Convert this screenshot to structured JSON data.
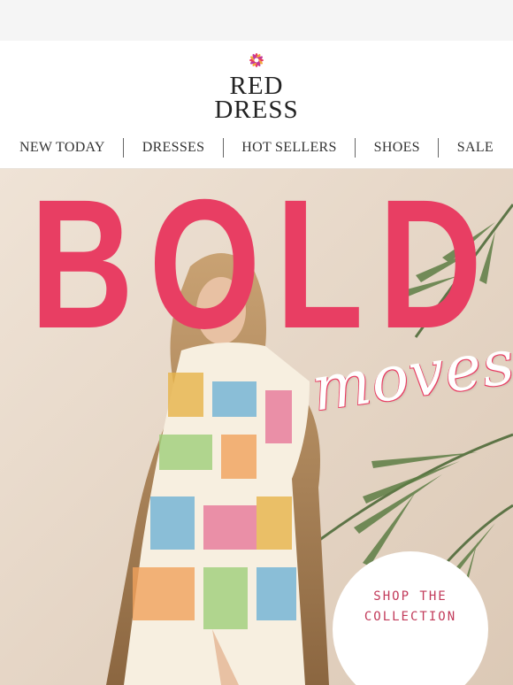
{
  "brand": {
    "line1": "RED",
    "line2": "DRESS",
    "logo_icon": "flower-icon"
  },
  "nav": {
    "items": [
      "NEW TODAY",
      "DRESSES",
      "HOT SELLERS",
      "SHOES",
      "SALE"
    ]
  },
  "hero": {
    "headline": "BOLD",
    "script_text": "moves",
    "cta_line1": "SHOP THE",
    "cta_line2": "COLLECTION",
    "accent_color": "#e83e63",
    "background_color": "#e9dccd"
  }
}
